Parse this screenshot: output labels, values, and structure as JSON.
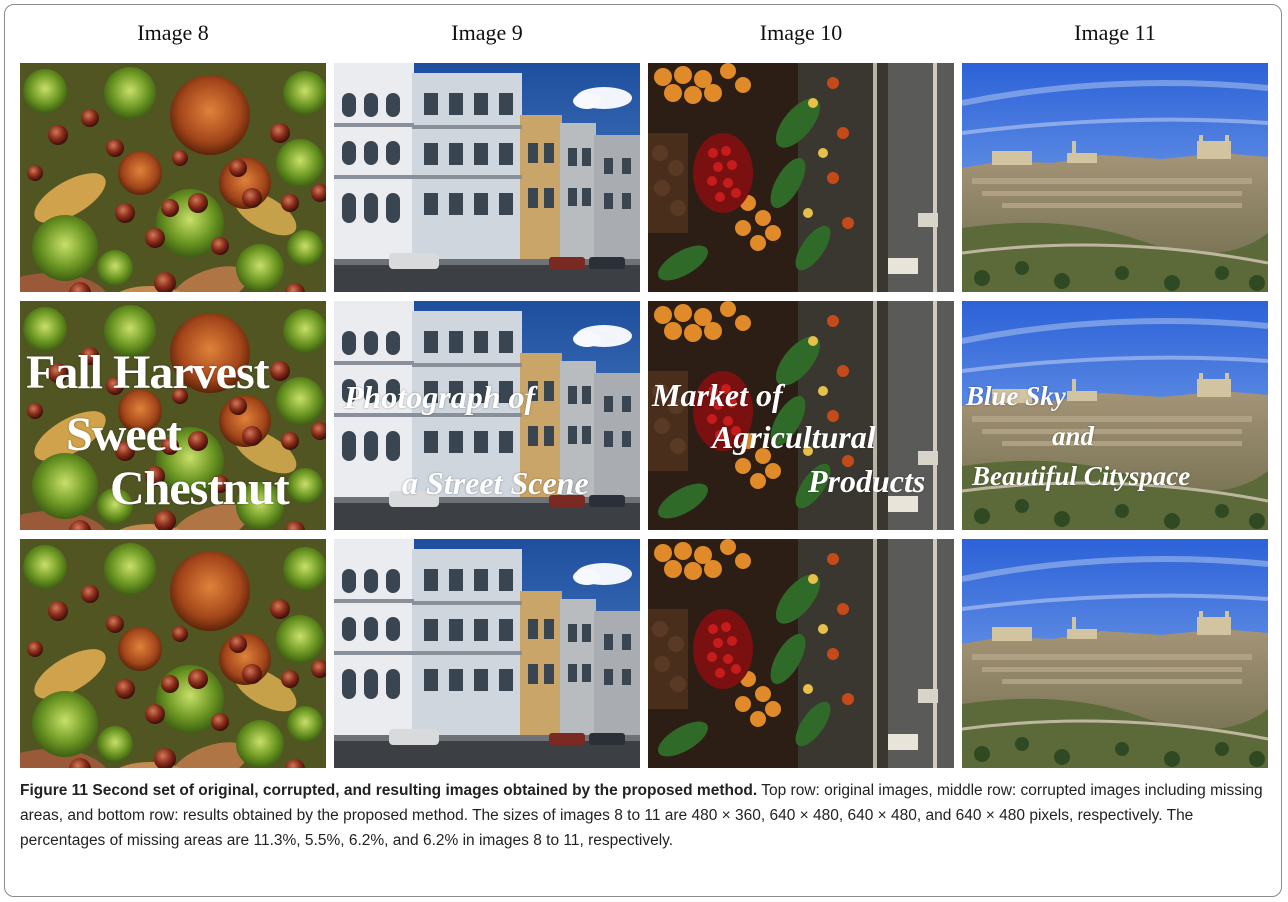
{
  "columns": [
    "Image 8",
    "Image 9",
    "Image 10",
    "Image 11"
  ],
  "rows": [
    "original",
    "corrupted",
    "result"
  ],
  "overlays": {
    "image8": [
      "Fall Harvest",
      "Sweet",
      "Chestnut"
    ],
    "image9": [
      "Photograph of",
      "a Street Scene"
    ],
    "image10": [
      "Market of",
      "Agricultural",
      "Products"
    ],
    "image11": [
      "Blue Sky",
      "and",
      "Beautiful Cityspace"
    ]
  },
  "caption": {
    "lead": "Figure 11 Second set of original, corrupted, and resulting images obtained by the proposed method.",
    "body": " Top row: original images, middle row: corrupted images including missing areas, and bottom row: results obtained by the proposed method. The sizes of images 8 to 11 are 480 × 360, 640 × 480, 640 × 480, and 640 × 480 pixels, respectively. The percentages of missing areas are 11.3%, 5.5%, 6.2%, and 6.2% in images 8 to 11, respectively."
  }
}
